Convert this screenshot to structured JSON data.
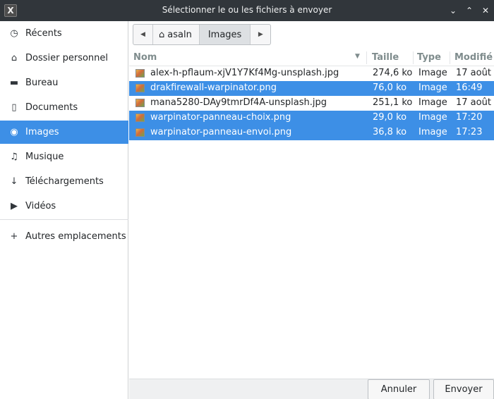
{
  "window": {
    "title": "Sélectionner le ou les fichiers à envoyer",
    "app_icon_glyph": "X",
    "buttons": {
      "minimize": "⌄",
      "maximize": "⌃",
      "close": "✕"
    }
  },
  "sidebar": {
    "items": [
      {
        "label": "Récents",
        "icon": "clock-icon",
        "glyph": "◷"
      },
      {
        "label": "Dossier personnel",
        "icon": "home-icon",
        "glyph": "⌂"
      },
      {
        "label": "Bureau",
        "icon": "folder-icon",
        "glyph": "▬"
      },
      {
        "label": "Documents",
        "icon": "document-icon",
        "glyph": "▯"
      },
      {
        "label": "Images",
        "icon": "camera-icon",
        "glyph": "◉",
        "selected": true
      },
      {
        "label": "Musique",
        "icon": "music-icon",
        "glyph": "♫"
      },
      {
        "label": "Téléchargements",
        "icon": "download-icon",
        "glyph": "↓"
      },
      {
        "label": "Vidéos",
        "icon": "video-icon",
        "glyph": "▶"
      }
    ],
    "other_locations": {
      "label": "Autres emplacements",
      "icon": "plus-icon",
      "glyph": "+"
    }
  },
  "pathbar": {
    "back_glyph": "◀",
    "forward_glyph": "▶",
    "home_label": "asaln",
    "home_glyph": "⌂",
    "current_label": "Images"
  },
  "columns": {
    "name": "Nom",
    "size": "Taille",
    "type": "Type",
    "modified": "Modifié",
    "sort_glyph": "▼"
  },
  "files": [
    {
      "name": "alex-h-pflaum-xjV1Y7Kf4Mg-unsplash.jpg",
      "size": "274,6 ko",
      "type": "Image",
      "modified": "17 août",
      "selected": false
    },
    {
      "name": "drakfirewall-warpinator.png",
      "size": "76,0 ko",
      "type": "Image",
      "modified": "16:49",
      "selected": true
    },
    {
      "name": "mana5280-DAy9tmrDf4A-unsplash.jpg",
      "size": "251,1 ko",
      "type": "Image",
      "modified": "17 août",
      "selected": false
    },
    {
      "name": "warpinator-panneau-choix.png",
      "size": "29,0 ko",
      "type": "Image",
      "modified": "17:20",
      "selected": true
    },
    {
      "name": "warpinator-panneau-envoi.png",
      "size": "36,8 ko",
      "type": "Image",
      "modified": "17:23",
      "selected": true
    }
  ],
  "actions": {
    "cancel": "Annuler",
    "send": "Envoyer"
  },
  "colors": {
    "selection": "#3d8fe6",
    "titlebar": "#31363b"
  }
}
